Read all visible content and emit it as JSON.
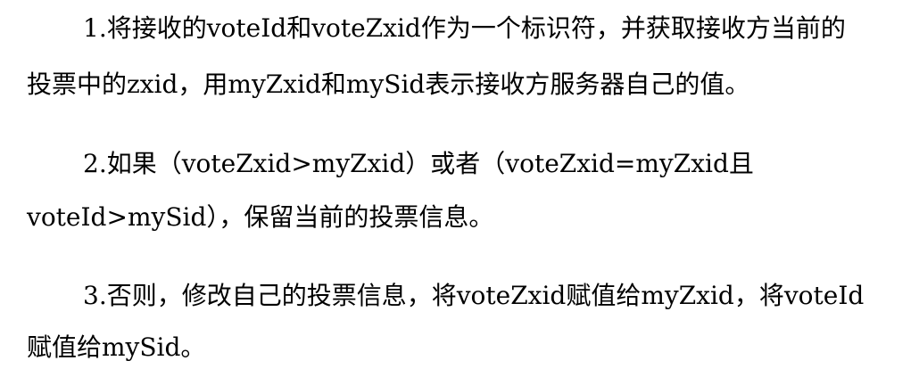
{
  "document": {
    "paragraphs": [
      {
        "lines": [
          "1.将接收的voteId和voteZxid作为一个标识符，并获取接收方当前的",
          "投票中的zxid，用myZxid和mySid表示接收方服务器自己的值。"
        ]
      },
      {
        "lines": [
          "2.如果（voteZxid>myZxid）或者（voteZxid=myZxid且",
          "voteId>mySid），保留当前的投票信息。"
        ]
      },
      {
        "lines": [
          "3.否则，修改自己的投票信息，将voteZxid赋值给myZxid，将voteId",
          "赋值给mySid。"
        ]
      }
    ]
  }
}
